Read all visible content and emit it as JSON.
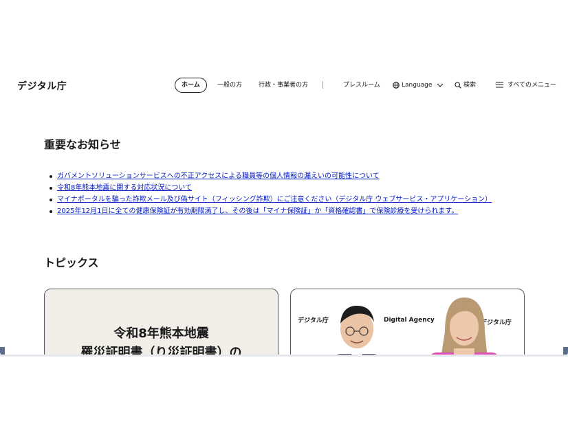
{
  "site": {
    "logo": "デジタル庁"
  },
  "nav": {
    "home": "ホーム",
    "general": "一般の方",
    "admin": "行政・事業者の方",
    "press": "プレスルーム",
    "language": "Language",
    "search": "検索",
    "menu": "すべてのメニュー"
  },
  "important": {
    "heading": "重要なお知らせ",
    "items": [
      "ガバメントソリューションサービスへの不正アクセスによる職員等の個人情報の漏えいの可能性について",
      "令和8年熊本地震に関する対応状況について",
      "マイナポータルを騙った詐欺メール及び偽サイト（フィッシング詐欺）にご注意ください（デジタル庁 ウェブサービス・アプリケーション）",
      "2025年12月1日に全ての健康保険証が有効期限満了し、その後は「マイナ保険証」か「資格確認書」で保険診療を受けられます。"
    ]
  },
  "topics": {
    "heading": "トピックス",
    "card1": {
      "line1": "令和8年熊本地震",
      "line2": "罹災証明書（り災証明書）の"
    },
    "card2": {
      "label_left": "デジタル庁",
      "label_center": "Digital Agency",
      "label_right": "デジタル庁"
    }
  }
}
